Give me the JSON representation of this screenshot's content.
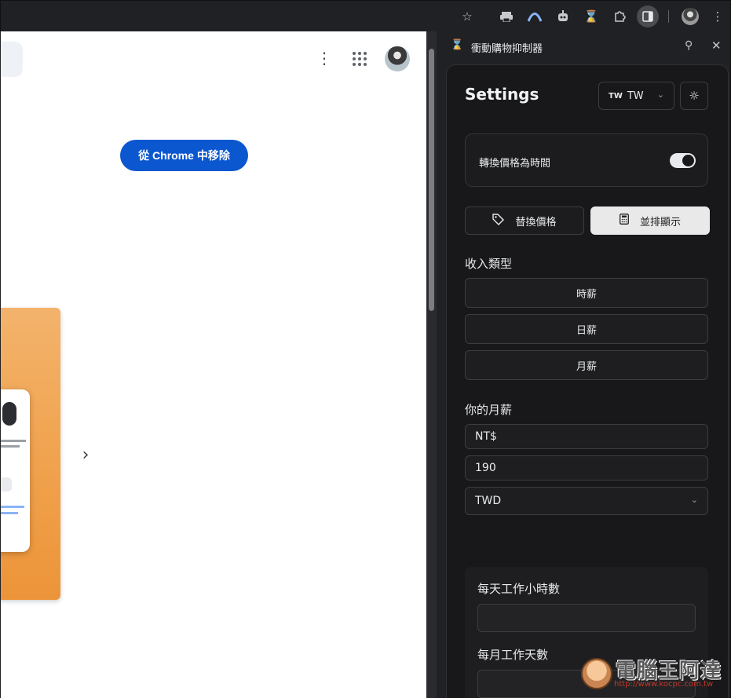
{
  "toolbar": {
    "icons": [
      "star-icon",
      "printer-icon",
      "arc-icon",
      "robot-icon",
      "hourglass-icon",
      "puzzle-icon",
      "side-panel-icon",
      "avatar",
      "more-icon"
    ]
  },
  "page": {
    "remove_button": "從 Chrome 中移除",
    "carousel_next_icon": "chevron-right-icon"
  },
  "panel": {
    "title": "衝動購物抑制器",
    "settings_title": "Settings",
    "language": {
      "flag": "TW",
      "value": "TW"
    },
    "toggle_label": "轉換價格為時間",
    "toggle_on": true,
    "modes": [
      {
        "label": "替換價格",
        "icon": "tag-icon"
      },
      {
        "label": "並排顯示",
        "icon": "calculator-icon",
        "selected": true
      }
    ],
    "income_type_label": "收入類型",
    "income_types": [
      "時薪",
      "日薪",
      "月薪"
    ],
    "salary_label": "你的月薪",
    "currency_symbol": "NT$",
    "salary_value": "190",
    "currency_code": "TWD",
    "hours_label": "每天工作小時數",
    "days_label": "每月工作天數",
    "hours_value": "",
    "days_value": ""
  },
  "watermark": {
    "text": "電腦王阿達",
    "url": "http://www.kocpc.com.tw"
  },
  "colors": {
    "chrome_bg": "#202124",
    "panel_bg": "#18181a",
    "primary_blue": "#0b57d0",
    "promo_orange": "#f0a04a"
  }
}
